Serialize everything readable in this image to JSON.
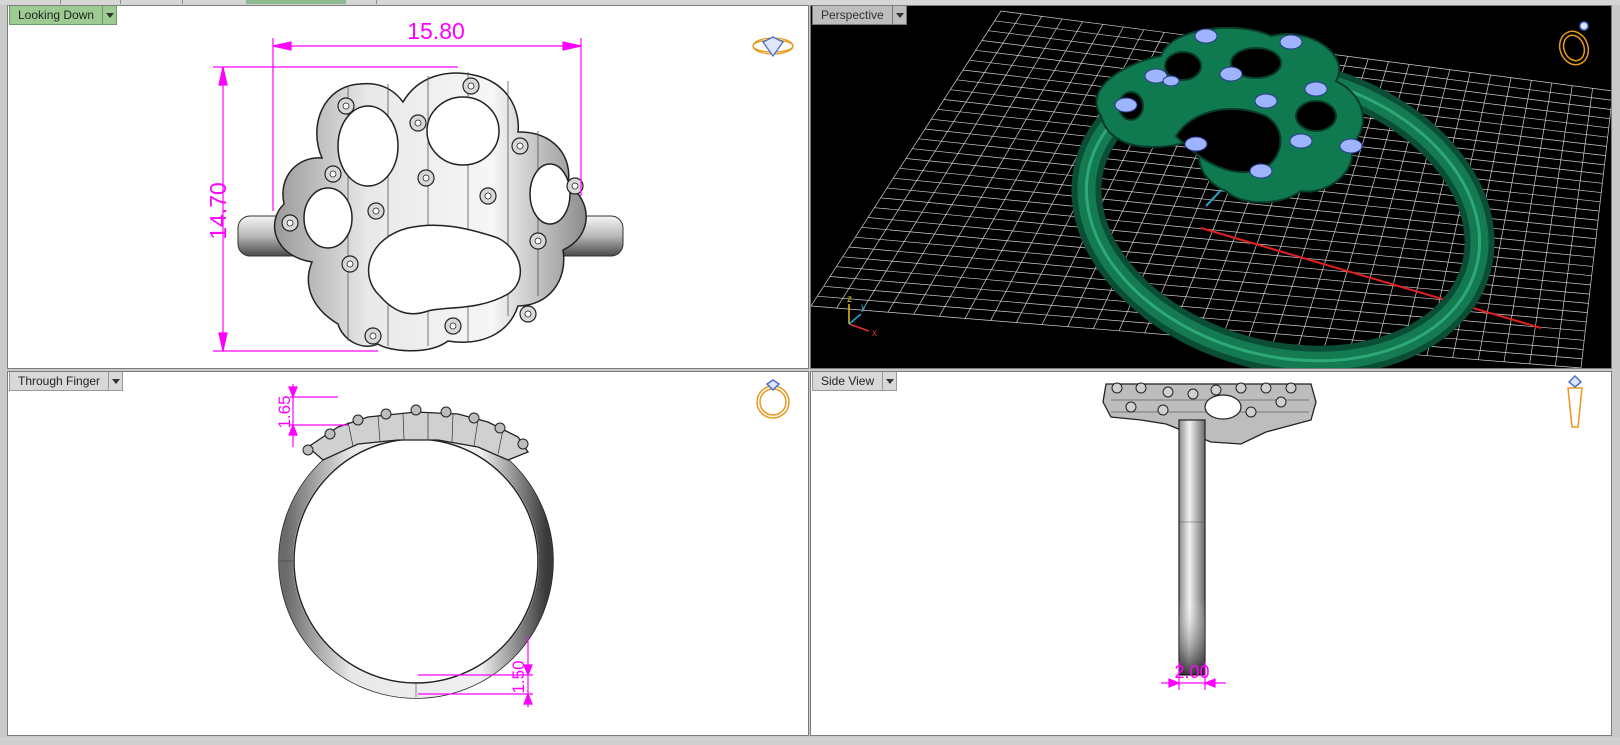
{
  "viewports": {
    "top_left": {
      "title": "Looking Down",
      "dims": {
        "width": "15.80",
        "height": "14.70"
      }
    },
    "top_right": {
      "title": "Perspective",
      "axes": {
        "x": "x",
        "y": "y",
        "z": "z"
      }
    },
    "bottom_left": {
      "title": "Through Finger",
      "dims": {
        "top": "1.65",
        "bottom": "1.50"
      }
    },
    "bottom_right": {
      "title": "Side View",
      "dims": {
        "width": "2.00"
      }
    }
  },
  "colors": {
    "dimension": "#ff00ff",
    "ring_green": "#0d6b4a",
    "gem_blue": "#9fb4ff",
    "grid": "#cfcfcf",
    "icon_orange": "#f0a020",
    "active_label": "#9ccc92"
  },
  "icons": {
    "top_left": "diamond-view-icon",
    "top_right": "ring-perspective-icon",
    "bottom_left": "ring-front-icon",
    "bottom_right": "ring-side-icon"
  }
}
